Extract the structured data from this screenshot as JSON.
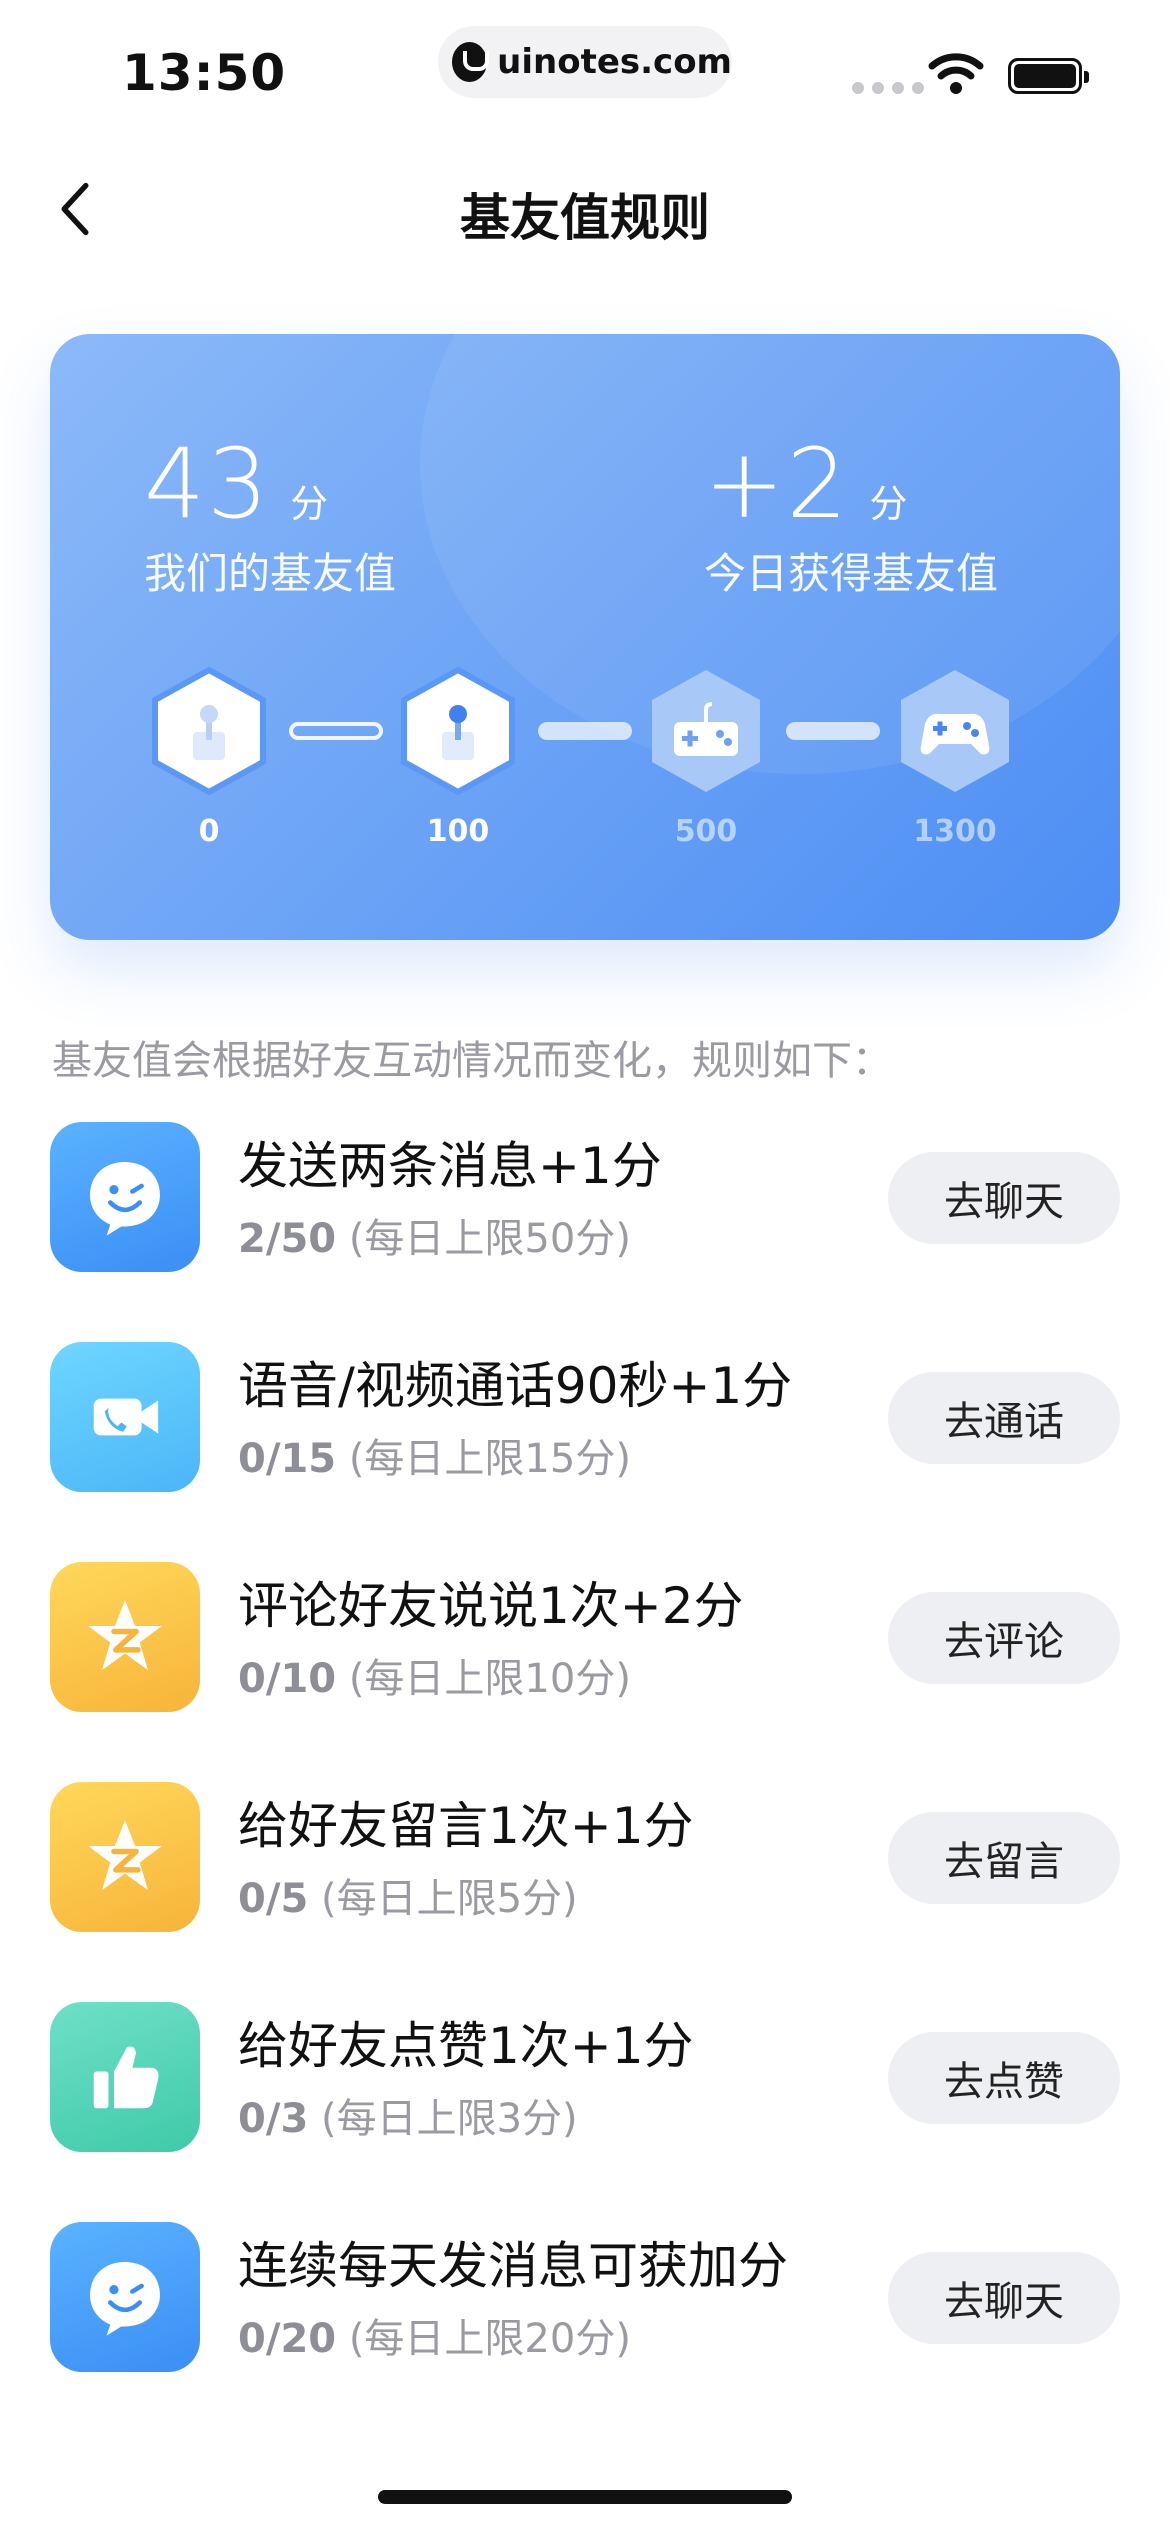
{
  "status_bar": {
    "time": "13:50",
    "url": "uinotes.com"
  },
  "nav": {
    "title": "基友值规则",
    "back_icon": "chevron-left-icon"
  },
  "summary": {
    "our_value": "43",
    "our_unit": "分",
    "our_caption": "我们的基友值",
    "today_value": "+2",
    "today_unit": "分",
    "today_caption": "今日获得基友值"
  },
  "levels": [
    {
      "label": "0",
      "icon": "joystick-icon",
      "reached": true
    },
    {
      "label": "100",
      "icon": "joystick-icon",
      "reached": true
    },
    {
      "label": "500",
      "icon": "game-console-icon",
      "reached": false
    },
    {
      "label": "1300",
      "icon": "gamepad-icon",
      "reached": false
    }
  ],
  "rules_intro": "基友值会根据好友互动情况而变化，规则如下：",
  "rules": [
    {
      "title": "发送两条消息+1分",
      "count": "2/50",
      "limit": "(每日上限50分)",
      "button": "去聊天",
      "icon": "chat-smile-icon",
      "color": "blue"
    },
    {
      "title": "语音/视频通话90秒+1分",
      "count": "0/15",
      "limit": "(每日上限15分)",
      "button": "去通话",
      "icon": "video-call-icon",
      "color": "cyan"
    },
    {
      "title": "评论好友说说1次+2分",
      "count": "0/10",
      "limit": "(每日上限10分)",
      "button": "去评论",
      "icon": "qzone-star-icon",
      "color": "yellow"
    },
    {
      "title": "给好友留言1次+1分",
      "count": "0/5",
      "limit": "(每日上限5分)",
      "button": "去留言",
      "icon": "qzone-star-icon",
      "color": "yellow"
    },
    {
      "title": "给好友点赞1次+1分",
      "count": "0/3",
      "limit": "(每日上限3分)",
      "button": "去点赞",
      "icon": "thumbs-up-icon",
      "color": "green"
    },
    {
      "title": "连续每天发消息可获加分",
      "count": "0/20",
      "limit": "(每日上限20分)",
      "button": "去聊天",
      "icon": "chat-smile-icon",
      "color": "blue"
    }
  ]
}
